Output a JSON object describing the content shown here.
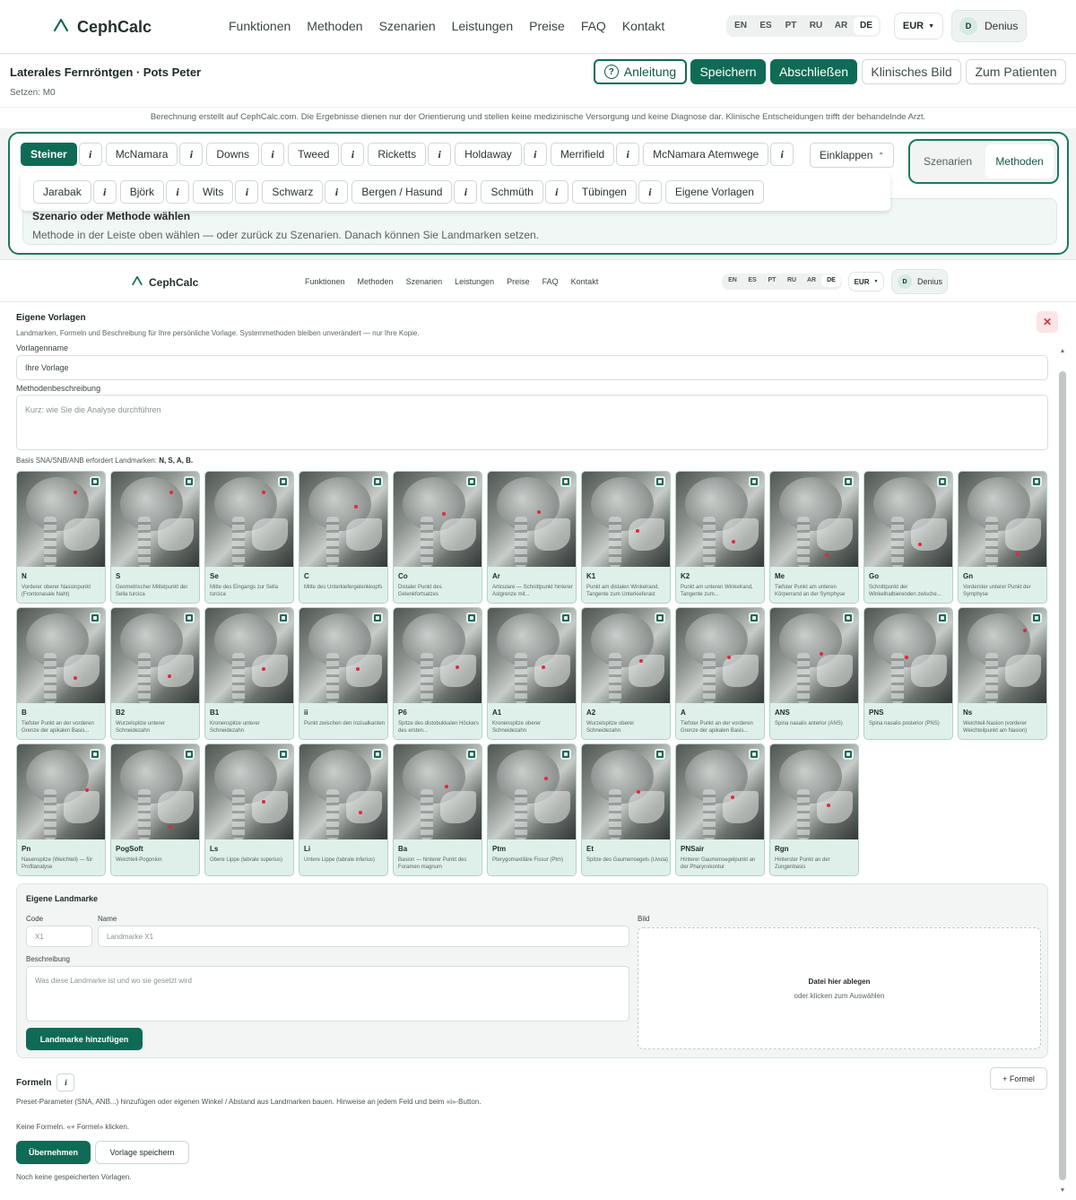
{
  "brand": {
    "name": "CephCalc"
  },
  "nav": {
    "links": [
      "Funktionen",
      "Methoden",
      "Szenarien",
      "Leistungen",
      "Preise",
      "FAQ",
      "Kontakt"
    ]
  },
  "langs": [
    "EN",
    "ES",
    "PT",
    "RU",
    "AR",
    "DE"
  ],
  "active_lang": "DE",
  "currency": "EUR",
  "user": {
    "initial": "D",
    "name": "Denius"
  },
  "page": {
    "title": "Laterales Fernröntgen · Pots Peter",
    "subtitle": "Setzen: M0",
    "buttons": {
      "guide": "Anleitung",
      "save": "Speichern",
      "finish": "Abschließen",
      "clinical": "Klinisches Bild",
      "patient": "Zum Patienten"
    },
    "disclaimer": "Berechnung erstellt auf CephCalc.com. Die Ergebnisse dienen nur der Orientierung und stellen keine medizinische Versorgung und keine Diagnose dar. Klinische Entscheidungen trifft der behandelnde Arzt."
  },
  "methods": {
    "row1": [
      "Steiner",
      "McNamara",
      "Downs",
      "Tweed",
      "Ricketts",
      "Holdaway",
      "Merrifield",
      "McNamara Atemwege"
    ],
    "row2": [
      "Jarabak",
      "Björk",
      "Wits",
      "Schwarz",
      "Bergen / Hasund",
      "Schmüth",
      "Tübingen"
    ],
    "own_templates": "Eigene Vorlagen",
    "info": "i",
    "collapse": "Einklappen",
    "toggle": [
      "Szenarien",
      "Methoden"
    ],
    "scenario_heading": "Szenario oder Methode wählen",
    "scenario_text": "Methode in der Leiste oben wählen — oder zurück zu Szenarien. Danach können Sie Landmarken setzen."
  },
  "templates": {
    "title": "Eigene Vorlagen",
    "subtitle": "Landmarken, Formeln und Beschreibung für Ihre persönliche Vorlage. Systemmethoden bleiben unverändert — nur Ihre Kopie.",
    "close": "✕",
    "name_label": "Vorlagenname",
    "name_value": "Ihre Vorlage",
    "desc_label": "Methodenbeschreibung",
    "desc_placeholder": "Kurz: wie Sie die Analyse durchführen",
    "hint_prefix": "Basis SNA/SNB/ANB erfordert Landmarken: ",
    "hint_codes": "N, S, A, B."
  },
  "landmarks": [
    {
      "code": "N",
      "desc": "Vorderer oberer Nasionpunkt (Frontonasale Naht)",
      "dot": [
        0.66,
        0.22
      ]
    },
    {
      "code": "S",
      "desc": "Geometrischer Mittelpunkt der Sella turcica",
      "dot": [
        0.68,
        0.22
      ]
    },
    {
      "code": "Se",
      "desc": "Mitte des Eingangs zur Sella turcica",
      "dot": [
        0.66,
        0.22
      ]
    },
    {
      "code": "C",
      "desc": "Mitte des Unterkiefergelenkkopfs",
      "dot": [
        0.64,
        0.37
      ]
    },
    {
      "code": "Co",
      "desc": "Distaler Punkt des Gelenkfortsatzes",
      "dot": [
        0.57,
        0.44
      ]
    },
    {
      "code": "Ar",
      "desc": "Articulare — Schnittpunkt hinterer Astgrenze mit...",
      "dot": [
        0.58,
        0.42
      ]
    },
    {
      "code": "K1",
      "desc": "Punkt am distalen Winkelrand, Tangente zum Unterkieferast",
      "dot": [
        0.63,
        0.62
      ]
    },
    {
      "code": "K2",
      "desc": "Punkt am unteren Winkelrand, Tangente zum...",
      "dot": [
        0.65,
        0.74
      ]
    },
    {
      "code": "Me",
      "desc": "Tiefster Punkt am unteren Körperrand an der Symphyse",
      "dot": [
        0.64,
        0.88
      ]
    },
    {
      "code": "Go",
      "desc": "Schnittpunkt der Winkelhalbierenden zwische...",
      "dot": [
        0.63,
        0.76
      ]
    },
    {
      "code": "Gn",
      "desc": "Vorderster unterer Punkt der Symphyse",
      "dot": [
        0.67,
        0.87
      ]
    },
    {
      "code": "B",
      "desc": "Tiefster Punkt an der vorderen Grenze der apikalen Basis...",
      "dot": [
        0.66,
        0.74
      ]
    },
    {
      "code": "B2",
      "desc": "Wurzelspitze unterer Schneidezahn",
      "dot": [
        0.66,
        0.72
      ]
    },
    {
      "code": "B1",
      "desc": "Kronenspitze unterer Schneidezahn",
      "dot": [
        0.66,
        0.64
      ]
    },
    {
      "code": "ii",
      "desc": "Punkt zwischen den Inzisalkanten",
      "dot": [
        0.66,
        0.64
      ]
    },
    {
      "code": "P6",
      "desc": "Spitze des distobukkalen Höckers des ersten...",
      "dot": [
        0.72,
        0.62
      ]
    },
    {
      "code": "A1",
      "desc": "Kronenspitze oberer Schneidezahn",
      "dot": [
        0.63,
        0.62
      ]
    },
    {
      "code": "A2",
      "desc": "Wurzelspitze oberer Schneidezahn",
      "dot": [
        0.67,
        0.56
      ]
    },
    {
      "code": "A",
      "desc": "Tiefster Punkt an der vorderen Grenze der apikalen Basis...",
      "dot": [
        0.6,
        0.52
      ]
    },
    {
      "code": "ANS",
      "desc": "Spina nasalis anterior (ANS)",
      "dot": [
        0.58,
        0.48
      ]
    },
    {
      "code": "PNS",
      "desc": "Spina nasalis posterior (PNS)",
      "dot": [
        0.48,
        0.52
      ]
    },
    {
      "code": "Ns",
      "desc": "Weichteil-Nasion (vorderer Weichteilpunkt am Nasion)",
      "dot": [
        0.76,
        0.24
      ]
    },
    {
      "code": "Pn",
      "desc": "Nasenspitze (Weichteil) — für Profilanalyse",
      "dot": [
        0.8,
        0.48
      ]
    },
    {
      "code": "PogSoft",
      "desc": "Weichteil-Pogonion",
      "dot": [
        0.67,
        0.87
      ]
    },
    {
      "code": "Ls",
      "desc": "Obere Lippe (labrale superius)",
      "dot": [
        0.66,
        0.6
      ]
    },
    {
      "code": "Li",
      "desc": "Untere Lippe (labrale inferius)",
      "dot": [
        0.69,
        0.72
      ]
    },
    {
      "code": "Ba",
      "desc": "Basion — hinterer Punkt des Foramen magnum",
      "dot": [
        0.6,
        0.44
      ]
    },
    {
      "code": "Ptm",
      "desc": "Pterygomaxilläre Fissur (Ptm)",
      "dot": [
        0.66,
        0.36
      ]
    },
    {
      "code": "Et",
      "desc": "Spitze des Gaumensegels (Uvula)",
      "dot": [
        0.64,
        0.5
      ]
    },
    {
      "code": "PNSair",
      "desc": "Hinterer Gaumensegelpunkt an der Pharynxkontur",
      "dot": [
        0.64,
        0.56
      ]
    },
    {
      "code": "Rgn",
      "desc": "Hinterster Punkt an der Zungenbasis",
      "dot": [
        0.66,
        0.64
      ]
    }
  ],
  "own_landmark": {
    "title": "Eigene Landmarke",
    "code_label": "Code",
    "code_placeholder": "X1",
    "name_label": "Name",
    "name_placeholder": "Landmarke X1",
    "image_label": "Bild",
    "desc_label": "Beschreibung",
    "desc_placeholder": "Was diese Landmarke ist und wo sie gesetzt wird",
    "drop_title": "Datei hier ablegen",
    "drop_sub": "oder klicken zum Auswählen",
    "add_button": "Landmarke hinzufügen"
  },
  "formulas": {
    "title": "Formeln",
    "info": "i",
    "add": "+ Formel",
    "hint": "Preset-Parameter (SNA, ANB...) hinzufügen oder eigenen Winkel / Abstand aus Landmarken bauen. Hinweise an jedem Feld und beim «i»-Button.",
    "empty": "Keine Formeln. «+ Formel» klicken.",
    "apply": "Übernehmen",
    "save_template": "Vorlage speichern",
    "no_templates": "Noch keine gespeicherten Vorlagen."
  }
}
